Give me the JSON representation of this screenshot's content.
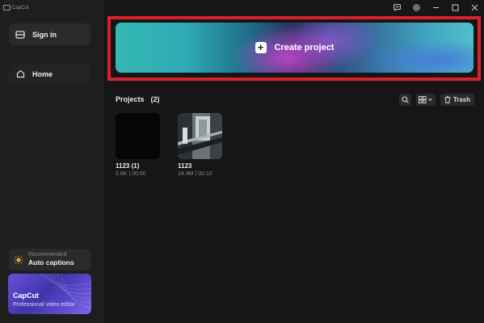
{
  "app": {
    "title": "CapCut"
  },
  "window_controls": [
    "feedback-icon",
    "settings-icon",
    "minimize-icon",
    "maximize-icon",
    "close-icon"
  ],
  "sidebar": {
    "signin_label": "Sign in",
    "home_label": "Home",
    "recommended_label": "Recommended",
    "recommended_title": "Auto captions",
    "promo_title": "CapCut",
    "promo_subtitle": "Professional video editor"
  },
  "main": {
    "create_label": "Create project",
    "projects_label": "Projects",
    "projects_count": "(2)",
    "trash_label": "Trash",
    "projects": [
      {
        "name": "1123 (1)",
        "meta": "2.6K | 00:00"
      },
      {
        "name": "1123",
        "meta": "24.4M | 00:10"
      }
    ]
  },
  "colors": {
    "highlight": "#d8222b",
    "background": "#161616",
    "sidebar": "#1e1e1e"
  }
}
